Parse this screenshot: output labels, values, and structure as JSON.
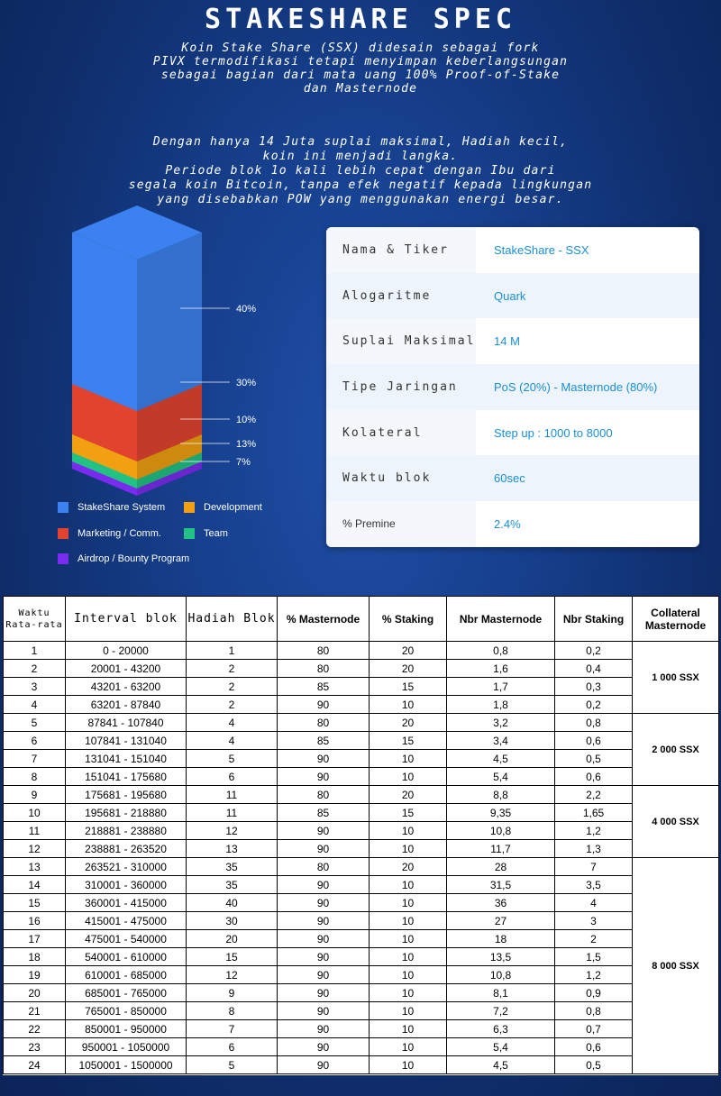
{
  "title": "STAKESHARE SPEC",
  "intro": {
    "p1": [
      "Koin Stake Share (SSX) didesain sebagai fork",
      "PIVX termodifikasi tetapi menyimpan keberlangsungan",
      "sebagai bagian dari mata uang 100% Proof-of-Stake",
      "dan Masternode"
    ],
    "p2": [
      "Dengan hanya 14 Juta suplai maksimal, Hadiah kecil,",
      "koin ini menjadi langka.",
      "Periode blok 1o kali lebih cepat dengan Ibu dari",
      "segala koin Bitcoin, tanpa efek negatif kepada lingkungan",
      "yang disebabkan POW yang menggunakan energi besar."
    ]
  },
  "chart_data": {
    "type": "stacked-3d-column",
    "segments": [
      {
        "name": "StakeShare System",
        "label": "40%",
        "color": "#3b82f0"
      },
      {
        "name": "Marketing / Comm.",
        "label": "30%",
        "color": "#e2432f"
      },
      {
        "name": "Development",
        "label": "10%",
        "color": "#f0a011"
      },
      {
        "name": "Team",
        "label": "13%",
        "color": "#22c184"
      },
      {
        "name": "Airdrop / Bounty Program",
        "label": "7%",
        "color": "#7a2bf0"
      }
    ]
  },
  "legend": {
    "items": [
      {
        "label": "StakeShare System",
        "color": "#3b82f0"
      },
      {
        "label": "Development",
        "color": "#f0a011"
      },
      {
        "label": "Marketing / Comm.",
        "color": "#e2432f"
      },
      {
        "label": "Team",
        "color": "#22c184"
      },
      {
        "label": "Airdrop / Bounty Program",
        "color": "#7a2bf0"
      }
    ]
  },
  "spec": [
    {
      "label": "Nama & Tiker",
      "value": "StakeShare - SSX"
    },
    {
      "label": "Alogaritme",
      "value": "Quark"
    },
    {
      "label": "Suplai Maksimal",
      "value": "14 M"
    },
    {
      "label": "Tipe Jaringan",
      "value": "PoS (20%) - Masternode (80%)"
    },
    {
      "label": "Kolateral",
      "value": "Step up : 1000 to 8000"
    },
    {
      "label": "Waktu blok",
      "value": "60sec"
    },
    {
      "label": "% Premine",
      "value": "2.4%"
    }
  ],
  "table": {
    "headers": [
      "Waktu Rata-rata",
      "Interval blok",
      "Hadiah Blok",
      "% Masternode",
      "% Staking",
      "Nbr Masternode",
      "Nbr Staking",
      "Collateral Masternode"
    ],
    "rows": [
      [
        "1",
        "0 - 20000",
        "1",
        "80",
        "20",
        "0,8",
        "0,2"
      ],
      [
        "2",
        "20001 - 43200",
        "2",
        "80",
        "20",
        "1,6",
        "0,4"
      ],
      [
        "3",
        "43201 - 63200",
        "2",
        "85",
        "15",
        "1,7",
        "0,3"
      ],
      [
        "4",
        "63201 - 87840",
        "2",
        "90",
        "10",
        "1,8",
        "0,2"
      ],
      [
        "5",
        "87841 - 107840",
        "4",
        "80",
        "20",
        "3,2",
        "0,8"
      ],
      [
        "6",
        "107841 - 131040",
        "4",
        "85",
        "15",
        "3,4",
        "0,6"
      ],
      [
        "7",
        "131041 - 151040",
        "5",
        "90",
        "10",
        "4,5",
        "0,5"
      ],
      [
        "8",
        "151041 - 175680",
        "6",
        "90",
        "10",
        "5,4",
        "0,6"
      ],
      [
        "9",
        "175681 - 195680",
        "11",
        "80",
        "20",
        "8,8",
        "2,2"
      ],
      [
        "10",
        "195681 - 218880",
        "11",
        "85",
        "15",
        "9,35",
        "1,65"
      ],
      [
        "11",
        "218881 - 238880",
        "12",
        "90",
        "10",
        "10,8",
        "1,2"
      ],
      [
        "12",
        "238881 - 263520",
        "13",
        "90",
        "10",
        "11,7",
        "1,3"
      ],
      [
        "13",
        "263521 - 310000",
        "35",
        "80",
        "20",
        "28",
        "7"
      ],
      [
        "14",
        "310001 - 360000",
        "35",
        "90",
        "10",
        "31,5",
        "3,5"
      ],
      [
        "15",
        "360001 - 415000",
        "40",
        "90",
        "10",
        "36",
        "4"
      ],
      [
        "16",
        "415001 - 475000",
        "30",
        "90",
        "10",
        "27",
        "3"
      ],
      [
        "17",
        "475001 - 540000",
        "20",
        "90",
        "10",
        "18",
        "2"
      ],
      [
        "18",
        "540001 - 610000",
        "15",
        "90",
        "10",
        "13,5",
        "1,5"
      ],
      [
        "19",
        "610001 - 685000",
        "12",
        "90",
        "10",
        "10,8",
        "1,2"
      ],
      [
        "20",
        "685001 - 765000",
        "9",
        "90",
        "10",
        "8,1",
        "0,9"
      ],
      [
        "21",
        "765001 - 850000",
        "8",
        "90",
        "10",
        "7,2",
        "0,8"
      ],
      [
        "22",
        "850001 - 950000",
        "7",
        "90",
        "10",
        "6,3",
        "0,7"
      ],
      [
        "23",
        "950001 - 1050000",
        "6",
        "90",
        "10",
        "5,4",
        "0,6"
      ],
      [
        "24",
        "1050001 - 1500000",
        "5",
        "90",
        "10",
        "4,5",
        "0,5"
      ]
    ],
    "collateral": [
      {
        "label": "1 000 SSX",
        "rows": 4
      },
      {
        "label": "2 000 SSX",
        "rows": 4
      },
      {
        "label": "4 000 SSX",
        "rows": 4
      },
      {
        "label": "8 000 SSX",
        "rows": 12
      }
    ]
  }
}
